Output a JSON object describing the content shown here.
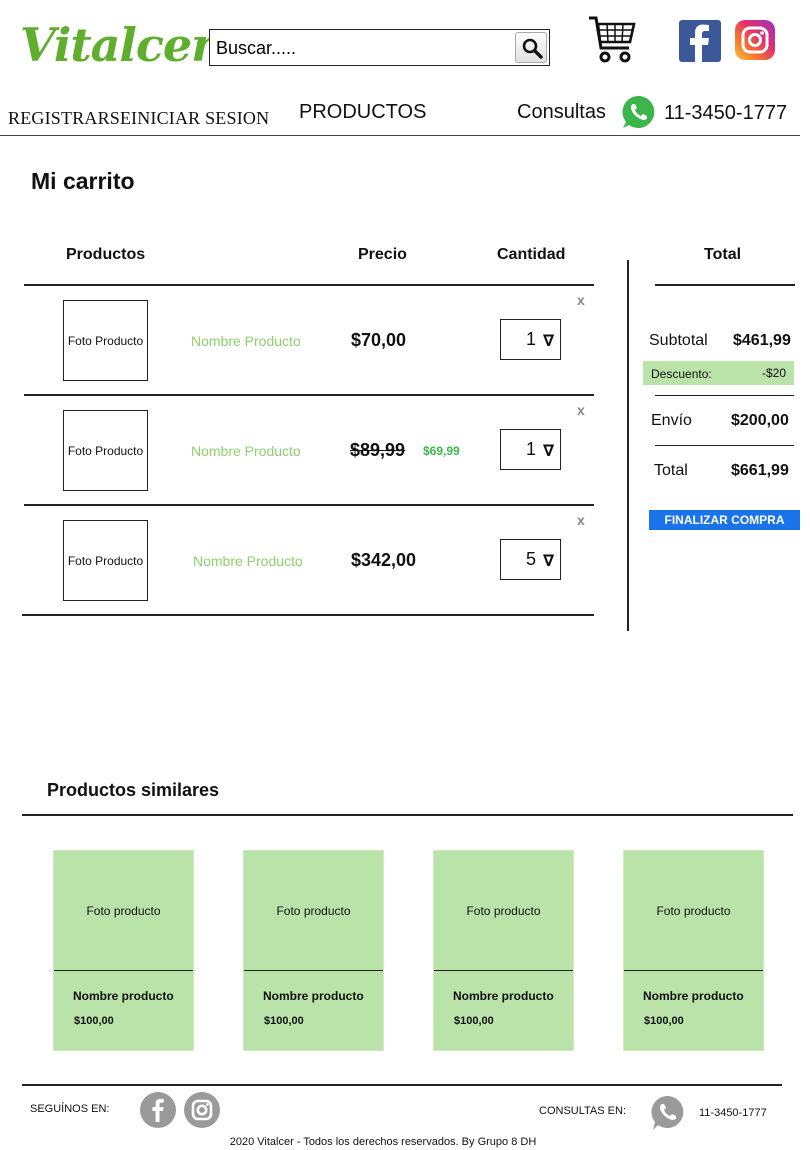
{
  "header": {
    "logo": "Vitalcer",
    "search": {
      "placeholder": "Buscar....."
    },
    "nav": {
      "register": "REGISTRARSE",
      "login": "INICIAR SESION",
      "products": "PRODUCTOS",
      "consultas": "Consultas",
      "phone": "11-3450-1777"
    }
  },
  "cart": {
    "title": "Mi carrito",
    "columns": {
      "products": "Productos",
      "price": "Precio",
      "quantity": "Cantidad",
      "total": "Total"
    },
    "items": [
      {
        "photo": "Foto Producto",
        "name": "Nombre Producto",
        "price": "$70,00",
        "quantity": "1",
        "remove": "x"
      },
      {
        "photo": "Foto Producto",
        "name": "Nombre Producto",
        "old_price": "$89,99",
        "new_price": "$69,99",
        "quantity": "1",
        "remove": "x"
      },
      {
        "photo": "Foto Producto",
        "name": "Nombre Producto",
        "price": "$342,00",
        "quantity": "5",
        "remove": "x"
      }
    ],
    "summary": {
      "subtotal_label": "Subtotal",
      "subtotal": "$461,99",
      "discount_label": "Descuento:",
      "discount": "-$20",
      "shipping_label": "Envío",
      "shipping": "$200,00",
      "total_label": "Total",
      "total": "$661,99",
      "checkout": "FINALIZAR COMPRA"
    }
  },
  "similar": {
    "title": "Productos similares",
    "items": [
      {
        "photo": "Foto producto",
        "name": "Nombre producto",
        "price": "$100,00"
      },
      {
        "photo": "Foto producto",
        "name": "Nombre producto",
        "price": "$100,00"
      },
      {
        "photo": "Foto producto",
        "name": "Nombre producto",
        "price": "$100,00"
      },
      {
        "photo": "Foto producto",
        "name": "Nombre producto",
        "price": "$100,00"
      }
    ]
  },
  "footer": {
    "follow": "SEGUÍNOS EN:",
    "consultas": "CONSULTAS EN:",
    "phone": "11-3450-1777",
    "copyright": "2020 Vitalcer - Todos los derechos reservados. By Grupo 8 DH"
  },
  "colors": {
    "brand_green": "#5fae2e",
    "light_green": "#b9e3a8",
    "link_green": "#8fcf6e",
    "button_blue": "#1a73e8",
    "facebook": "#3b5998"
  },
  "icons": [
    "search-icon",
    "cart-icon",
    "facebook-icon",
    "instagram-icon",
    "whatsapp-icon",
    "dropdown-arrow-icon"
  ]
}
